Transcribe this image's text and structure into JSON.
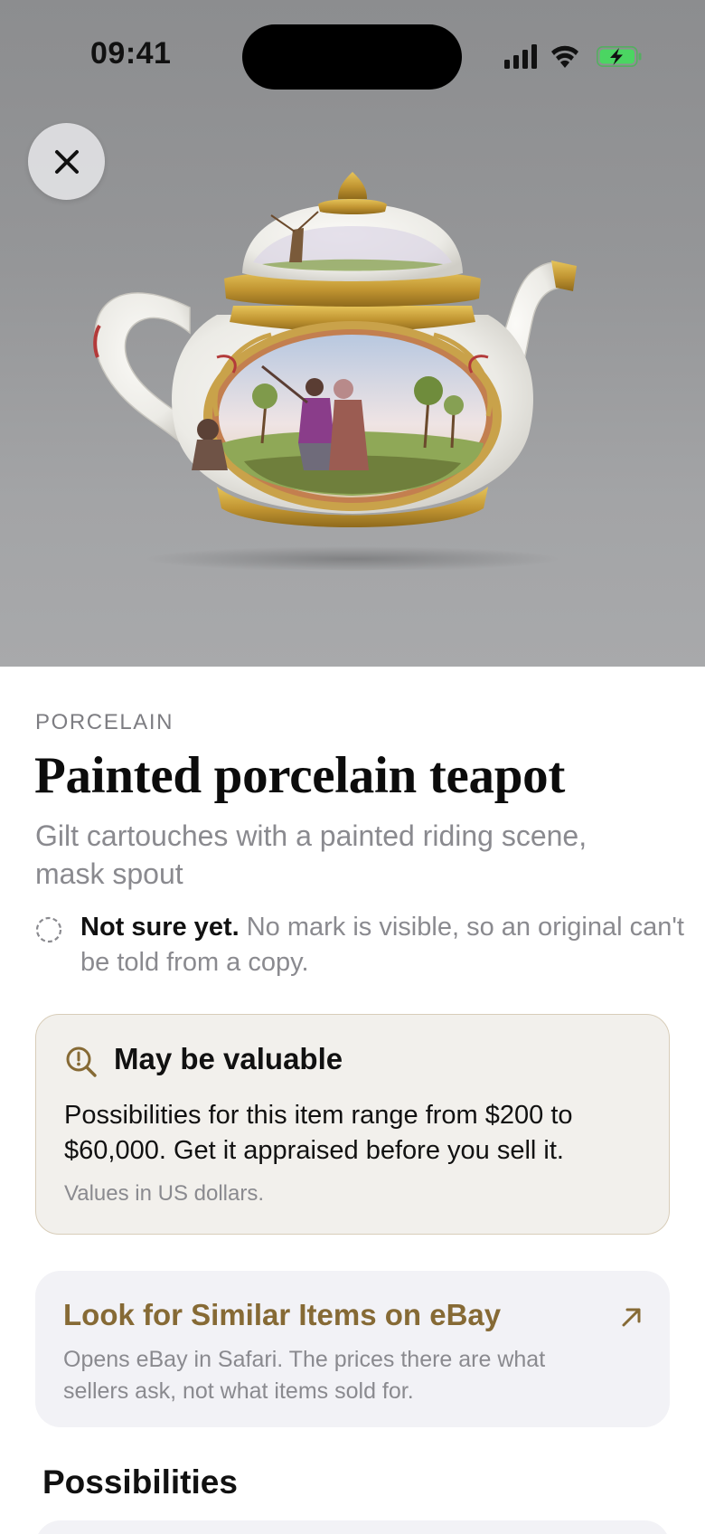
{
  "status_bar": {
    "time": "09:41",
    "icons": [
      "signal-icon",
      "wifi-icon",
      "battery-charging-icon"
    ]
  },
  "hero": {
    "close_icon": "close-icon",
    "image_subject": "teapot-image"
  },
  "item": {
    "category": "PORCELAIN",
    "title": "Painted porcelain teapot",
    "subtitle": "Gilt cartouches with a painted riding scene, mask spout",
    "status_label": "Not sure yet.",
    "status_detail": "No mark is visible, so an original can't be told from a copy."
  },
  "value_card": {
    "icon": "magnifier-alert-icon",
    "title": "May be valuable",
    "body": "Possibilities for this item range from $200 to $60,000. Get it appraised before you sell it.",
    "note": "Values in US dollars."
  },
  "ebay_card": {
    "title": "Look for Similar Items on eBay",
    "subtitle": "Opens eBay in Safari. The prices there are what sellers ask, not what items sold for.",
    "icon": "external-arrow-icon"
  },
  "sections": {
    "possibilities_title": "Possibilities"
  },
  "colors": {
    "accent": "#866a35",
    "card_background": "#f2f0ec",
    "card_border": "#d8cdb9",
    "secondary_text": "#8a8a8f"
  }
}
